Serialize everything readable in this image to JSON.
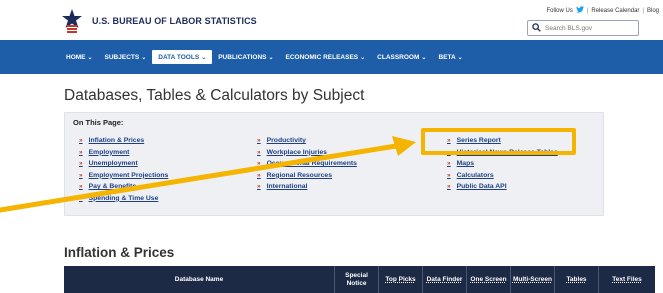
{
  "header": {
    "title": "U.S. BUREAU OF LABOR STATISTICS",
    "top_links": {
      "follow_us": "Follow Us",
      "release_calendar": "Release Calendar",
      "blog": "Blog"
    },
    "search": {
      "placeholder": "Search BLS.gov"
    }
  },
  "nav": {
    "items": [
      {
        "label": "HOME"
      },
      {
        "label": "SUBJECTS"
      },
      {
        "label": "DATA TOOLS"
      },
      {
        "label": "PUBLICATIONS"
      },
      {
        "label": "ECONOMIC RELEASES"
      },
      {
        "label": "CLASSROOM"
      },
      {
        "label": "BETA"
      }
    ],
    "active": "DATA TOOLS"
  },
  "page": {
    "title": "Databases, Tables & Calculators by Subject"
  },
  "on_this_page": {
    "title": "On This Page:",
    "col1": [
      "Inflation & Prices",
      "Employment",
      "Unemployment",
      "Employment Projections",
      "Pay & Benefits",
      "Spending & Time Use"
    ],
    "col2": [
      "Productivity",
      "Workplace Injuries",
      "Occupational Requirements",
      "Regional Resources",
      "International"
    ],
    "col3": [
      "Series Report",
      "Historical News Release Tables",
      "Maps",
      "Calculators",
      "Public Data API"
    ]
  },
  "section": {
    "title": "Inflation & Prices",
    "columns": [
      {
        "label": "Database Name"
      },
      {
        "label": "Special Notice"
      },
      {
        "label": "Top Picks"
      },
      {
        "label": "Data Finder"
      },
      {
        "label": "One Screen"
      },
      {
        "label": "Multi-Screen"
      },
      {
        "label": "Tables"
      },
      {
        "label": "Text Files"
      }
    ]
  },
  "colors": {
    "nav_bg": "#1e5ea8",
    "table_head_bg": "#1d2a46",
    "highlight": "#f5b400",
    "link": "#1e3f85"
  }
}
